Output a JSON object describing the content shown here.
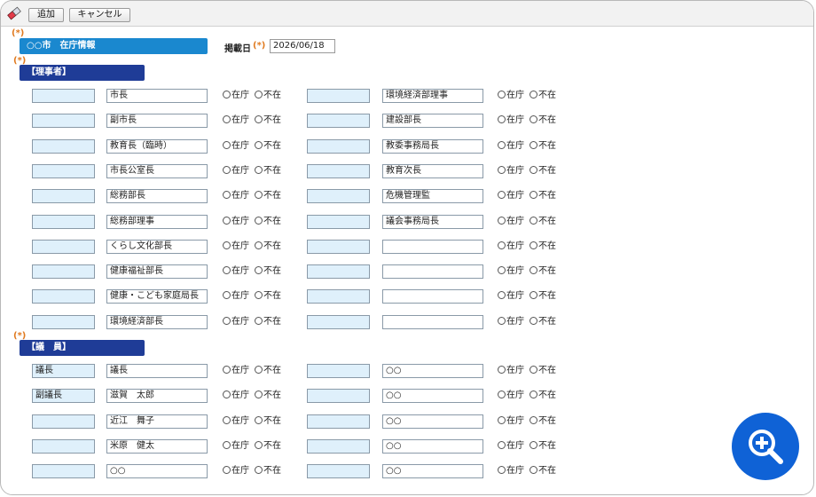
{
  "toolbar": {
    "add_label": "追加",
    "cancel_label": "キャンセル"
  },
  "required_mark": "(*)",
  "city_title": "○○市　在庁情報",
  "date": {
    "label": "掲載日",
    "required_mark": "(*)",
    "value": "2026/06/18"
  },
  "sections": {
    "riji": {
      "title": "【理事者】",
      "rows": [
        {
          "left": {
            "id": "",
            "name": "市長"
          },
          "right": {
            "id": "",
            "name": "環境経済部理事"
          }
        },
        {
          "left": {
            "id": "",
            "name": "副市長"
          },
          "right": {
            "id": "",
            "name": "建設部長"
          }
        },
        {
          "left": {
            "id": "",
            "name": "教育長（臨時）"
          },
          "right": {
            "id": "",
            "name": "教委事務局長"
          }
        },
        {
          "left": {
            "id": "",
            "name": "市長公室長"
          },
          "right": {
            "id": "",
            "name": "教育次長"
          }
        },
        {
          "left": {
            "id": "",
            "name": "総務部長"
          },
          "right": {
            "id": "",
            "name": "危機管理監"
          }
        },
        {
          "left": {
            "id": "",
            "name": "総務部理事"
          },
          "right": {
            "id": "",
            "name": "議会事務局長"
          }
        },
        {
          "left": {
            "id": "",
            "name": "くらし文化部長"
          },
          "right": {
            "id": "",
            "name": ""
          }
        },
        {
          "left": {
            "id": "",
            "name": "健康福祉部長"
          },
          "right": {
            "id": "",
            "name": ""
          }
        },
        {
          "left": {
            "id": "",
            "name": "健康・こども家庭局長"
          },
          "right": {
            "id": "",
            "name": ""
          }
        },
        {
          "left": {
            "id": "",
            "name": "環境経済部長"
          },
          "right": {
            "id": "",
            "name": ""
          }
        }
      ]
    },
    "giin": {
      "title": "【議　員】",
      "rows": [
        {
          "left": {
            "id": "議長",
            "name": "議長"
          },
          "right": {
            "id": "",
            "name": "○○"
          }
        },
        {
          "left": {
            "id": "副議長",
            "name": "滋賀　太郎"
          },
          "right": {
            "id": "",
            "name": "○○"
          }
        },
        {
          "left": {
            "id": "",
            "name": "近江　舞子"
          },
          "right": {
            "id": "",
            "name": "○○"
          }
        },
        {
          "left": {
            "id": "",
            "name": "米原　健太"
          },
          "right": {
            "id": "",
            "name": "○○"
          }
        },
        {
          "left": {
            "id": "",
            "name": "○○"
          },
          "right": {
            "id": "",
            "name": "○○"
          }
        }
      ]
    }
  },
  "radio_labels": {
    "in": "在庁",
    "out": "不在"
  },
  "zoom_button": {
    "icon": "zoom-in-icon"
  },
  "colors": {
    "city_bar": "#1a88cf",
    "section_bar": "#1f3c97",
    "required": "#e07a1f",
    "zoom": "#0f62d6",
    "id_cell": "#dff0fb"
  }
}
